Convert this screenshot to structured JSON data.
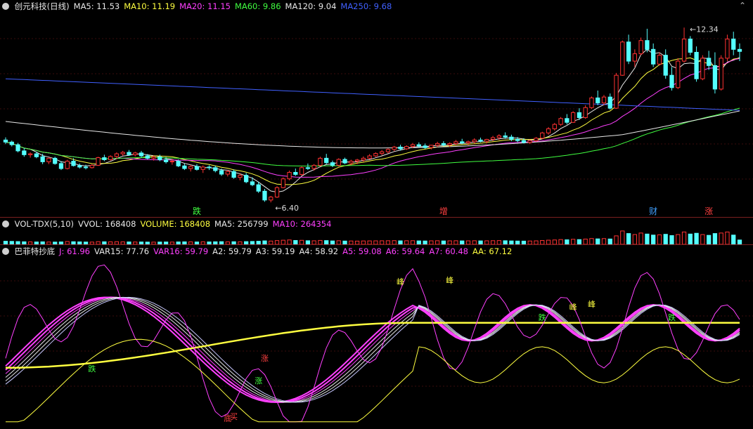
{
  "panels": {
    "price": {
      "header": [
        {
          "text": "创元科技(日线)",
          "color": "#e8e8e8"
        },
        {
          "text": "MA5: 11.53",
          "color": "#e8e8e8"
        },
        {
          "text": "MA10: 11.19",
          "color": "#ffff40"
        },
        {
          "text": "MA20: 11.15",
          "color": "#ff40ff"
        },
        {
          "text": "MA60: 9.86",
          "color": "#40ff40"
        },
        {
          "text": "MA120: 9.04",
          "color": "#e8e8e8"
        },
        {
          "text": "MA250: 9.68",
          "color": "#4060ff"
        }
      ],
      "high_label": "12.34",
      "low_label": "6.40",
      "markers": [
        {
          "text": "跌",
          "x_index": 78,
          "color": "#40ff40"
        },
        {
          "text": "增",
          "x_index": 178,
          "color": "#ff4040"
        },
        {
          "text": "财",
          "x_index": 262,
          "color": "#40a0ff"
        },
        {
          "text": "涨",
          "x_index": 284,
          "color": "#ff4040"
        }
      ]
    },
    "volume": {
      "header": [
        {
          "text": "VOL-TDX(5,10)",
          "color": "#e8e8e8"
        },
        {
          "text": "VVOL: 168408",
          "color": "#e8e8e8"
        },
        {
          "text": "VOLUME: 168408",
          "color": "#ffff40"
        },
        {
          "text": "MA5: 256799",
          "color": "#e8e8e8"
        },
        {
          "text": "MA10: 264354",
          "color": "#ff40ff"
        }
      ]
    },
    "indicator": {
      "header": [
        {
          "text": "巴菲特抄底",
          "color": "#e8e8e8"
        },
        {
          "text": "J: 61.96",
          "color": "#ff40ff"
        },
        {
          "text": "VAR15: 77.76",
          "color": "#e8e8e8"
        },
        {
          "text": "VAR16: 59.79",
          "color": "#ff40ff"
        },
        {
          "text": "A2: 59.79",
          "color": "#e8e8e8"
        },
        {
          "text": "A3: 59.19",
          "color": "#e8e8e8"
        },
        {
          "text": "A4: 58.92",
          "color": "#e8e8e8"
        },
        {
          "text": "A5: 59.08",
          "color": "#ff40ff"
        },
        {
          "text": "A6: 59.64",
          "color": "#ff40ff"
        },
        {
          "text": "A7: 60.48",
          "color": "#ff40ff"
        },
        {
          "text": "AA: 67.12",
          "color": "#ffff40"
        }
      ],
      "signals": [
        {
          "text": "底",
          "x_index": 90,
          "y": 5,
          "color": "#ff4040"
        },
        {
          "text": "买",
          "x_index": 93,
          "y": 6,
          "color": "#ff4040"
        },
        {
          "text": "涨",
          "x_index": 106,
          "y": 45,
          "color": "#ff4040"
        },
        {
          "text": "涨",
          "x_index": 103,
          "y": 30,
          "color": "#40ff40"
        },
        {
          "text": "跌",
          "x_index": 36,
          "y": 38,
          "color": "#40ff40"
        },
        {
          "text": "峰",
          "x_index": 161,
          "y": 96,
          "color": "#ffff40"
        },
        {
          "text": "峰",
          "x_index": 181,
          "y": 97,
          "color": "#ffff40"
        },
        {
          "text": "跌",
          "x_index": 217,
          "y": 72,
          "color": "#40ff40"
        },
        {
          "text": "峰",
          "x_index": 229,
          "y": 79,
          "color": "#ffff40"
        },
        {
          "text": "峰",
          "x_index": 238,
          "y": 81,
          "color": "#ffff40"
        },
        {
          "text": "跌",
          "x_index": 269,
          "y": 72,
          "color": "#40ff40"
        }
      ]
    }
  },
  "chart_data": [
    {
      "type": "candlestick",
      "ylim": [
        6.0,
        12.8
      ],
      "candles_ohlc": [
        [
          8.52,
          8.61,
          8.38,
          8.45
        ],
        [
          8.45,
          8.5,
          8.3,
          8.36
        ],
        [
          8.36,
          8.42,
          8.1,
          8.15
        ],
        [
          8.15,
          8.25,
          7.95,
          8.02
        ],
        [
          8.02,
          8.1,
          7.92,
          8.05
        ],
        [
          8.05,
          8.12,
          7.9,
          7.95
        ],
        [
          7.95,
          8.05,
          7.7,
          7.78
        ],
        [
          7.78,
          7.92,
          7.7,
          7.9
        ],
        [
          7.9,
          7.95,
          7.68,
          7.72
        ],
        [
          7.72,
          7.8,
          7.5,
          7.55
        ],
        [
          7.55,
          7.85,
          7.52,
          7.8
        ],
        [
          7.8,
          7.9,
          7.62,
          7.65
        ],
        [
          7.65,
          7.72,
          7.55,
          7.6
        ],
        [
          7.6,
          7.68,
          7.52,
          7.58
        ],
        [
          7.58,
          7.7,
          7.55,
          7.66
        ],
        [
          7.66,
          7.95,
          7.64,
          7.92
        ],
        [
          7.92,
          8.02,
          7.8,
          7.85
        ],
        [
          7.85,
          8.0,
          7.82,
          7.96
        ],
        [
          7.96,
          8.1,
          7.88,
          8.05
        ],
        [
          8.05,
          8.15,
          7.98,
          8.1
        ],
        [
          8.1,
          8.18,
          7.98,
          8.02
        ],
        [
          8.02,
          8.12,
          7.96,
          8.08
        ],
        [
          8.08,
          8.15,
          7.92,
          7.98
        ],
        [
          7.98,
          8.04,
          7.86,
          7.9
        ],
        [
          7.9,
          8.0,
          7.82,
          7.94
        ],
        [
          7.94,
          8.02,
          7.8,
          7.85
        ],
        [
          7.85,
          7.94,
          7.72,
          7.78
        ],
        [
          7.78,
          7.88,
          7.68,
          7.8
        ],
        [
          7.8,
          7.86,
          7.6,
          7.64
        ],
        [
          7.64,
          7.72,
          7.5,
          7.55
        ],
        [
          7.55,
          7.68,
          7.45,
          7.62
        ],
        [
          7.62,
          7.7,
          7.48,
          7.52
        ],
        [
          7.52,
          7.66,
          7.4,
          7.6
        ],
        [
          7.6,
          7.66,
          7.5,
          7.58
        ],
        [
          7.58,
          7.65,
          7.42,
          7.48
        ],
        [
          7.48,
          7.55,
          7.3,
          7.36
        ],
        [
          7.36,
          7.5,
          7.28,
          7.45
        ],
        [
          7.45,
          7.52,
          7.2,
          7.25
        ],
        [
          7.25,
          7.38,
          7.15,
          7.32
        ],
        [
          7.32,
          7.4,
          7.05,
          7.1
        ],
        [
          7.1,
          7.25,
          6.95,
          7.0
        ],
        [
          7.0,
          7.1,
          6.72,
          6.78
        ],
        [
          6.78,
          6.86,
          6.42,
          6.48
        ],
        [
          6.48,
          6.62,
          6.4,
          6.58
        ],
        [
          6.58,
          6.95,
          6.55,
          6.9
        ],
        [
          6.9,
          7.25,
          6.88,
          7.2
        ],
        [
          7.2,
          7.48,
          7.15,
          7.42
        ],
        [
          7.42,
          7.55,
          7.3,
          7.35
        ],
        [
          7.35,
          7.62,
          7.3,
          7.58
        ],
        [
          7.58,
          7.72,
          7.5,
          7.55
        ],
        [
          7.55,
          7.7,
          7.48,
          7.66
        ],
        [
          7.66,
          7.95,
          7.62,
          7.9
        ],
        [
          7.9,
          8.05,
          7.7,
          7.75
        ],
        [
          7.75,
          7.82,
          7.6,
          7.66
        ],
        [
          7.66,
          7.9,
          7.62,
          7.86
        ],
        [
          7.86,
          7.92,
          7.7,
          7.74
        ],
        [
          7.74,
          7.85,
          7.66,
          7.8
        ],
        [
          7.8,
          7.88,
          7.7,
          7.84
        ],
        [
          7.84,
          7.96,
          7.78,
          7.9
        ],
        [
          7.9,
          8.04,
          7.86,
          7.98
        ],
        [
          7.98,
          8.1,
          7.94,
          8.06
        ],
        [
          8.06,
          8.18,
          8.0,
          8.12
        ],
        [
          8.12,
          8.24,
          8.06,
          8.2
        ],
        [
          8.2,
          8.32,
          8.14,
          8.28
        ],
        [
          8.28,
          8.36,
          8.16,
          8.22
        ],
        [
          8.22,
          8.34,
          8.18,
          8.3
        ],
        [
          8.3,
          8.42,
          8.24,
          8.36
        ],
        [
          8.36,
          8.44,
          8.26,
          8.32
        ],
        [
          8.32,
          8.4,
          8.22,
          8.26
        ],
        [
          8.26,
          8.36,
          8.2,
          8.34
        ],
        [
          8.34,
          8.46,
          8.28,
          8.4
        ],
        [
          8.4,
          8.48,
          8.3,
          8.35
        ],
        [
          8.35,
          8.44,
          8.28,
          8.4
        ],
        [
          8.4,
          8.52,
          8.34,
          8.46
        ],
        [
          8.46,
          8.56,
          8.38,
          8.42
        ],
        [
          8.42,
          8.5,
          8.34,
          8.46
        ],
        [
          8.46,
          8.58,
          8.4,
          8.52
        ],
        [
          8.52,
          8.6,
          8.44,
          8.48
        ],
        [
          8.48,
          8.56,
          8.4,
          8.54
        ],
        [
          8.54,
          8.66,
          8.48,
          8.6
        ],
        [
          8.6,
          8.72,
          8.52,
          8.66
        ],
        [
          8.66,
          8.78,
          8.56,
          8.62
        ],
        [
          8.62,
          8.7,
          8.48,
          8.54
        ],
        [
          8.54,
          8.62,
          8.44,
          8.5
        ],
        [
          8.5,
          8.58,
          8.4,
          8.44
        ],
        [
          8.44,
          8.54,
          8.38,
          8.5
        ],
        [
          8.5,
          8.62,
          8.46,
          8.58
        ],
        [
          8.58,
          8.8,
          8.54,
          8.76
        ],
        [
          8.76,
          8.96,
          8.7,
          8.9
        ],
        [
          8.9,
          9.1,
          8.84,
          9.05
        ],
        [
          9.05,
          9.3,
          9.0,
          9.25
        ],
        [
          9.25,
          9.4,
          9.05,
          9.12
        ],
        [
          9.12,
          9.5,
          9.1,
          9.45
        ],
        [
          9.45,
          9.6,
          9.2,
          9.28
        ],
        [
          9.28,
          9.7,
          9.24,
          9.62
        ],
        [
          9.62,
          10.0,
          9.58,
          9.95
        ],
        [
          9.95,
          10.2,
          9.7,
          9.78
        ],
        [
          9.78,
          10.05,
          9.7,
          9.98
        ],
        [
          9.98,
          10.1,
          9.55,
          9.6
        ],
        [
          9.6,
          10.8,
          9.58,
          10.72
        ],
        [
          10.72,
          11.9,
          10.7,
          11.85
        ],
        [
          11.85,
          12.1,
          11.1,
          11.2
        ],
        [
          11.2,
          11.6,
          11.0,
          11.45
        ],
        [
          11.45,
          12.0,
          11.4,
          11.9
        ],
        [
          11.9,
          12.3,
          11.5,
          11.6
        ],
        [
          11.6,
          11.8,
          11.0,
          11.1
        ],
        [
          11.1,
          11.5,
          11.05,
          11.4
        ],
        [
          11.4,
          11.6,
          10.6,
          10.72
        ],
        [
          10.72,
          11.0,
          10.2,
          10.3
        ],
        [
          10.3,
          11.3,
          10.25,
          11.2
        ],
        [
          11.2,
          12.34,
          11.15,
          11.95
        ],
        [
          11.95,
          12.05,
          11.4,
          11.5
        ],
        [
          11.5,
          11.7,
          10.5,
          10.6
        ],
        [
          10.6,
          11.4,
          10.55,
          11.3
        ],
        [
          11.3,
          11.55,
          10.9,
          11.05
        ],
        [
          11.05,
          11.5,
          10.1,
          10.25
        ],
        [
          10.25,
          11.4,
          10.2,
          11.3
        ],
        [
          11.3,
          12.1,
          11.2,
          11.95
        ],
        [
          11.95,
          12.2,
          11.4,
          11.6
        ],
        [
          11.6,
          11.8,
          11.2,
          11.53
        ]
      ],
      "ma_series": [
        {
          "name": "MA5",
          "color": "#e8e8e8",
          "last": 11.53
        },
        {
          "name": "MA10",
          "color": "#ffff40",
          "last": 11.19
        },
        {
          "name": "MA20",
          "color": "#ff40ff",
          "last": 11.15
        },
        {
          "name": "MA60",
          "color": "#40ff40",
          "last": 9.86
        },
        {
          "name": "MA120",
          "color": "#e8e8e8",
          "last": 9.04
        },
        {
          "name": "MA250",
          "color": "#4060ff",
          "last": 9.68
        }
      ]
    },
    {
      "type": "bar",
      "series": [
        {
          "name": "VOLUME",
          "values": [
            120000,
            115000,
            108000,
            100000,
            96000,
            92000,
            98000,
            90000,
            88000,
            94000,
            110000,
            102000,
            96000,
            90000,
            88000,
            104000,
            100000,
            98000,
            102000,
            96000,
            94000,
            90000,
            92000,
            88000,
            86000,
            90000,
            92000,
            88000,
            94000,
            98000,
            96000,
            92000,
            98000,
            94000,
            100000,
            104000,
            96000,
            102000,
            98000,
            106000,
            112000,
            120000,
            135000,
            128000,
            146000,
            160000,
            170000,
            150000,
            156000,
            140000,
            138000,
            152000,
            146000,
            132000,
            140000,
            128000,
            130000,
            126000,
            132000,
            134000,
            136000,
            138000,
            140000,
            144000,
            136000,
            140000,
            142000,
            134000,
            130000,
            136000,
            140000,
            132000,
            136000,
            140000,
            134000,
            136000,
            140000,
            134000,
            138000,
            142000,
            146000,
            140000,
            132000,
            128000,
            126000,
            130000,
            136000,
            150000,
            162000,
            170000,
            186000,
            176000,
            196000,
            184000,
            204000,
            226000,
            212000,
            224000,
            208000,
            330000,
            520000,
            420000,
            380000,
            440000,
            400000,
            360000,
            370000,
            390000,
            340000,
            380000,
            480000,
            400000,
            430000,
            380000,
            350000,
            420000,
            440000,
            480000,
            360000,
            168408
          ]
        }
      ],
      "ylim": [
        0,
        600000
      ]
    },
    {
      "type": "line",
      "series": [
        {
          "name": "J",
          "color": "#ff40ff"
        },
        {
          "name": "VAR15",
          "color": "#e8e8e8"
        },
        {
          "name": "AA",
          "color": "#ffff40"
        }
      ],
      "ylim": [
        0,
        110
      ]
    }
  ]
}
